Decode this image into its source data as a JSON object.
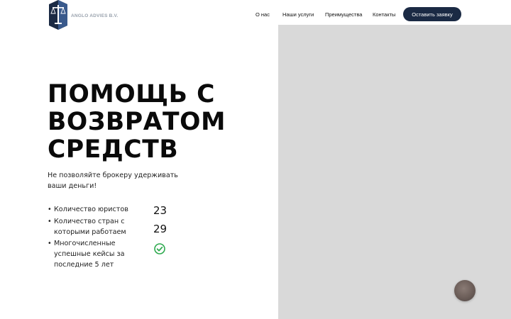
{
  "header": {
    "logo_text": "ANGLO ADVIES B.V.",
    "nav": [
      "О нас",
      "Наши услуги",
      "Преимущества",
      "Контакты"
    ],
    "cta_label": "Оставить заявку"
  },
  "hero": {
    "title_lines": [
      "ПОМОЩЬ С",
      "ВОЗВРАТОМ",
      "СРЕДСТВ"
    ],
    "subtitle": "Не позволяйте брокеру удерживать ваши деньги!",
    "stats": [
      {
        "bullet": "•",
        "label": "Количество юристов",
        "value": "23"
      },
      {
        "bullet": "•",
        "label": "Количество стран с которыми работаем",
        "value": "29"
      },
      {
        "bullet": "•",
        "label": "Многочисленные успешные кейсы за последние 5 лет",
        "value_icon": "check-circle-icon"
      }
    ]
  },
  "colors": {
    "brand_navy": "#1b2a44",
    "logo_gray": "#9aa3ae",
    "check_green": "#2eaa4f",
    "media_placeholder": "#d9d9d9"
  },
  "icons": {
    "logo": "scales-of-justice-logo",
    "chat": "chat-avatar-icon"
  }
}
